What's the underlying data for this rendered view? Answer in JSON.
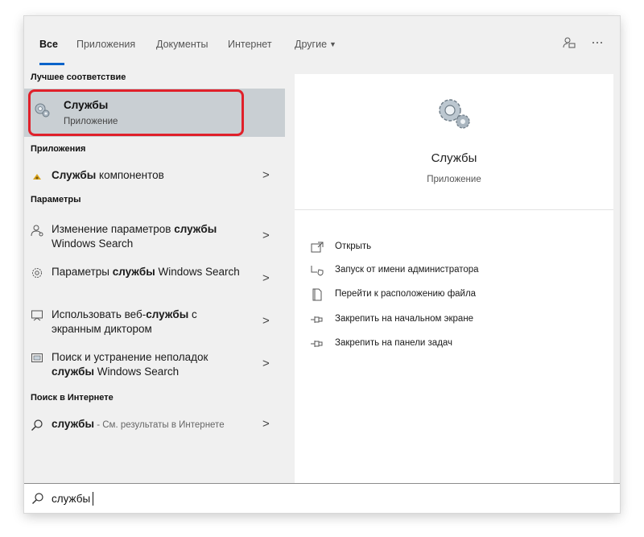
{
  "tabs": [
    {
      "label": "Все"
    },
    {
      "label": "Приложения"
    },
    {
      "label": "Документы"
    },
    {
      "label": "Интернет"
    },
    {
      "label": "Другие"
    }
  ],
  "top_icons": [
    "feedback-icon",
    "more-icon"
  ],
  "left": {
    "best_match_header": "Лучшее соответствие",
    "best_match": {
      "title": "Службы",
      "subtitle": "Приложение",
      "icon": "services-gear-icon"
    },
    "apps_header": "Приложения",
    "apps": [
      {
        "bold": "Службы",
        "rest": " компонентов",
        "icon": "component-services-icon"
      }
    ],
    "settings_header": "Параметры",
    "settings": [
      {
        "pre": "Изменение параметров ",
        "bold": "службы",
        "post": " Windows Search",
        "icon": "user-gear-icon"
      },
      {
        "pre": "Параметры ",
        "bold": "службы",
        "post": " Windows Search",
        "icon": "gear-icon"
      },
      {
        "pre": "Использовать веб-",
        "bold": "службы",
        "post": " с экранным диктором",
        "icon": "narrator-icon"
      },
      {
        "pre": "Поиск и устранение неполадок ",
        "bold": "службы",
        "post": " Windows Search",
        "icon": "troubleshoot-icon"
      }
    ],
    "web_header": "Поиск в Интернете",
    "web": {
      "bold": "службы",
      "rest": " - См. результаты в Интернете",
      "icon": "search-icon"
    }
  },
  "right": {
    "title": "Службы",
    "subtitle": "Приложение",
    "actions": [
      {
        "label": "Открыть",
        "icon": "open-icon"
      },
      {
        "label": "Запуск от имени администратора",
        "icon": "run-as-admin-icon"
      },
      {
        "label": "Перейти к расположению файла",
        "icon": "file-location-icon"
      },
      {
        "label": "Закрепить на начальном экране",
        "icon": "pin-icon"
      },
      {
        "label": "Закрепить на панели задач",
        "icon": "pin-icon"
      }
    ]
  },
  "search": {
    "value": "службы"
  },
  "colors": {
    "accent": "#0a63c9",
    "highlight_border": "#e0202a",
    "selected_bg": "#c9cfd3"
  }
}
